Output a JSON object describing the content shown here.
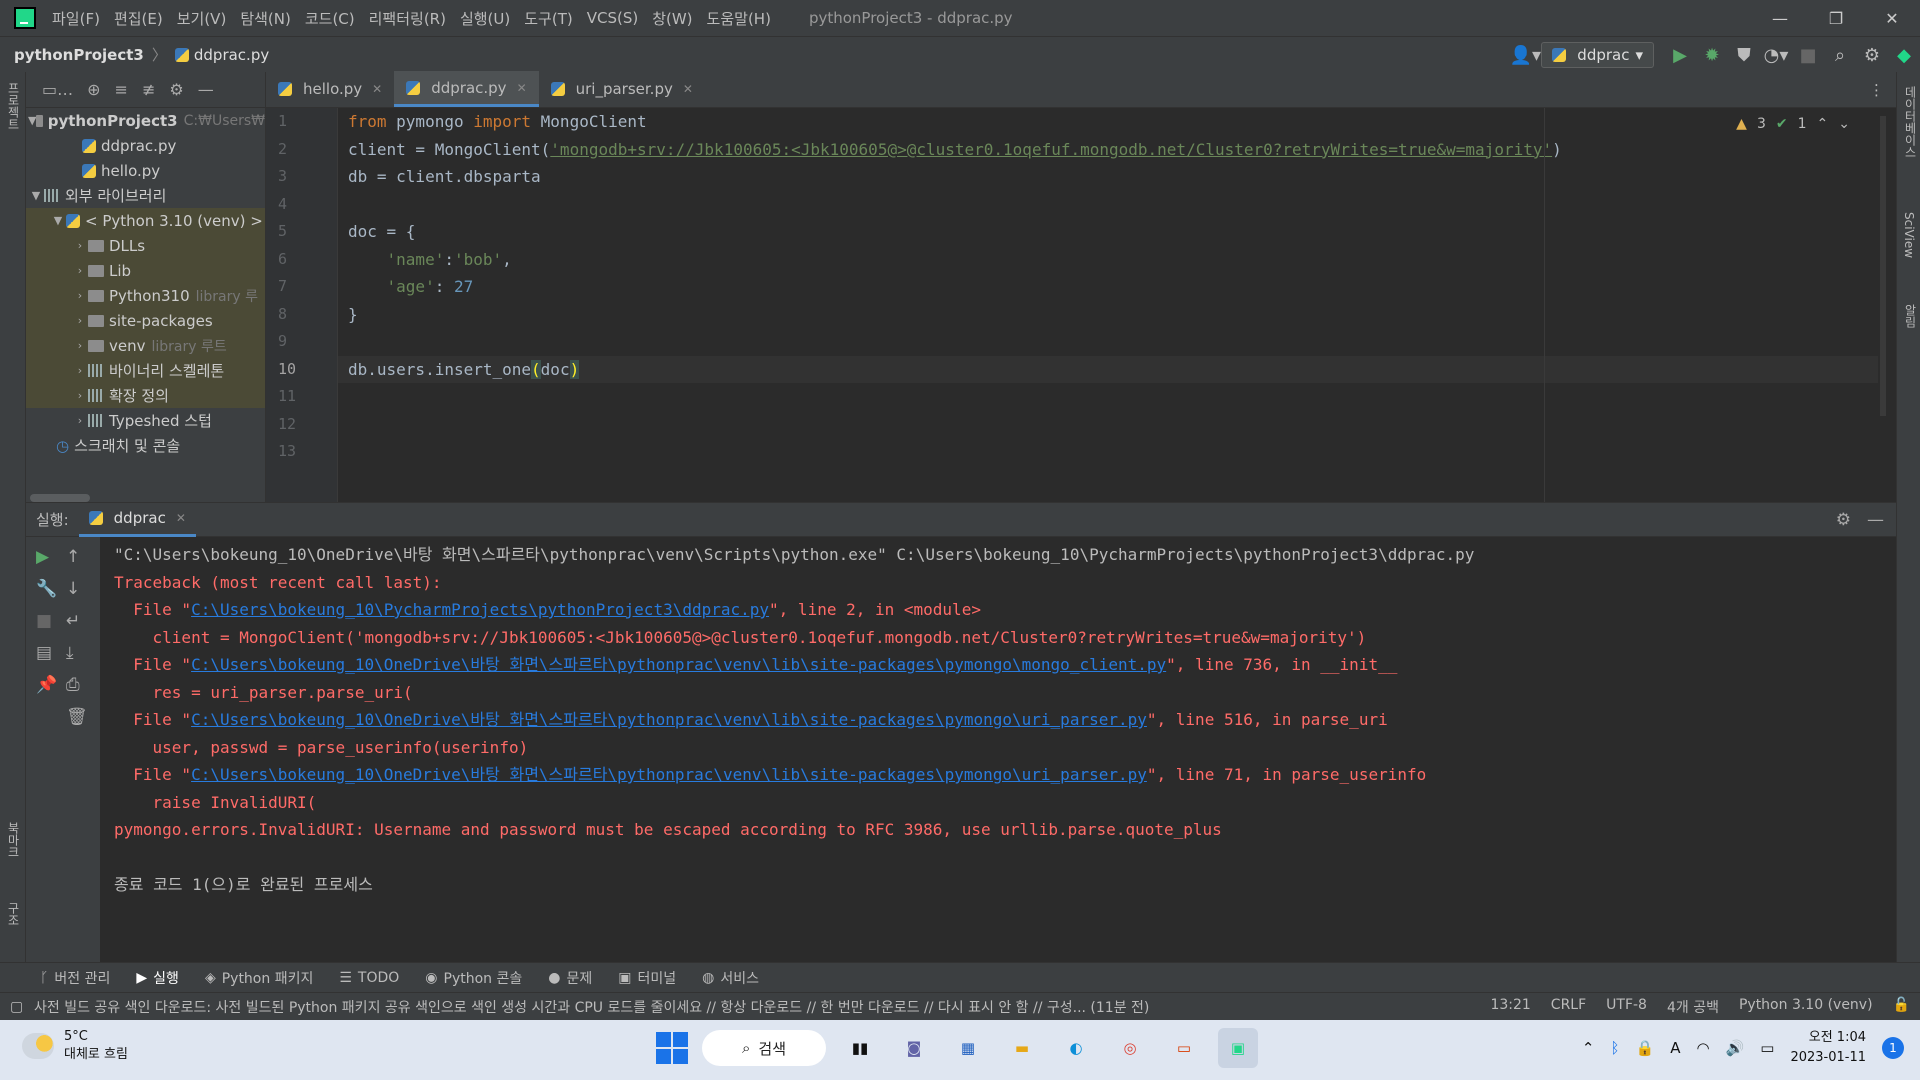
{
  "menubar": {
    "items": [
      "파일(F)",
      "편집(E)",
      "보기(V)",
      "탐색(N)",
      "코드(C)",
      "리팩터링(R)",
      "실행(U)",
      "도구(T)",
      "VCS(S)",
      "창(W)",
      "도움말(H)"
    ],
    "window_title": "pythonProject3 - ddprac.py",
    "minimize": "—",
    "restore": "❐",
    "close": "✕"
  },
  "navbar": {
    "project": "pythonProject3",
    "file": "ddprac.py",
    "run_config": "ddprac"
  },
  "left_strip": {
    "project_label": "프로젝트",
    "bookmarks_label": "북마크",
    "structure_label": "구조"
  },
  "right_strip": {
    "database_label": "데이터베이스",
    "sciview_label": "SciView",
    "notifications_label": "알림"
  },
  "project_tree": {
    "root": "pythonProject3",
    "root_hint": "C:₩Users₩",
    "files": [
      "ddprac.py",
      "hello.py"
    ],
    "external_libs": "외부 라이브러리",
    "python_env": "< Python 3.10 (venv) >",
    "children": [
      {
        "label": "DLLs",
        "hint": ""
      },
      {
        "label": "Lib",
        "hint": ""
      },
      {
        "label": "Python310",
        "hint": "library 루"
      },
      {
        "label": "site-packages",
        "hint": ""
      },
      {
        "label": "venv",
        "hint": "library 루트"
      },
      {
        "label": "바이너리 스켈레톤",
        "hint": ""
      },
      {
        "label": "확장 정의",
        "hint": ""
      },
      {
        "label": "Typeshed 스텁",
        "hint": ""
      }
    ],
    "scratches": "스크래치 및 콘솔"
  },
  "editor": {
    "tabs": [
      "hello.py",
      "ddprac.py",
      "uri_parser.py"
    ],
    "active_tab": "ddprac.py",
    "warnings": "3",
    "ok_count": "1",
    "line_numbers": [
      "1",
      "2",
      "3",
      "4",
      "5",
      "6",
      "7",
      "8",
      "9",
      "10",
      "11",
      "12",
      "13"
    ],
    "code": {
      "l1_from": "from",
      "l1_mod": " pymongo ",
      "l1_import": "import",
      "l1_rest": " MongoClient",
      "l2_pre": "client = MongoClient(",
      "l2_str": "'mongodb+srv://Jbk100605:<Jbk100605@>@cluster0.1oqefuf.mongodb.net/Cluster0?retryWrites=true&w=majority'",
      "l2_post": ")",
      "l3": "db = client.dbsparta",
      "l5": "doc = {",
      "l6_key": "    'name'",
      "l6_colon": ":",
      "l6_val": "'bob'",
      "l6_comma": ",",
      "l7_key": "    'age'",
      "l7_colon": ": ",
      "l7_val": "27",
      "l8": "}",
      "l10_pre": "db.users.insert_one",
      "l10_open": "(",
      "l10_arg": "doc",
      "l10_close": ")"
    }
  },
  "run": {
    "label": "실행:",
    "tab": "ddprac",
    "console": {
      "cmd": "\"C:\\Users\\bokeung_10\\OneDrive\\바탕 화면\\스파르타\\pythonprac\\venv\\Scripts\\python.exe\" C:\\Users\\bokeung_10\\PycharmProjects\\pythonProject3\\ddprac.py",
      "traceback": "Traceback (most recent call last):",
      "f1_pre": "  File \"",
      "f1_link": "C:\\Users\\bokeung_10\\PycharmProjects\\pythonProject3\\ddprac.py",
      "f1_post": "\", line 2, in <module>",
      "f1_code": "    client = MongoClient('mongodb+srv://Jbk100605:<Jbk100605@>@cluster0.1oqefuf.mongodb.net/Cluster0?retryWrites=true&w=majority')",
      "f2_pre": "  File \"",
      "f2_link": "C:\\Users\\bokeung_10\\OneDrive\\바탕 화면\\스파르타\\pythonprac\\venv\\lib\\site-packages\\pymongo\\mongo_client.py",
      "f2_post": "\", line 736, in __init__",
      "f2_code": "    res = uri_parser.parse_uri(",
      "f3_pre": "  File \"",
      "f3_link": "C:\\Users\\bokeung_10\\OneDrive\\바탕 화면\\스파르타\\pythonprac\\venv\\lib\\site-packages\\pymongo\\uri_parser.py",
      "f3_post": "\", line 516, in parse_uri",
      "f3_code": "    user, passwd = parse_userinfo(userinfo)",
      "f4_pre": "  File \"",
      "f4_link": "C:\\Users\\bokeung_10\\OneDrive\\바탕 화면\\스파르타\\pythonprac\\venv\\lib\\site-packages\\pymongo\\uri_parser.py",
      "f4_post": "\", line 71, in parse_userinfo",
      "f4_code": "    raise InvalidURI(",
      "error": "pymongo.errors.InvalidURI: Username and password must be escaped according to RFC 3986, use urllib.parse.quote_plus",
      "exit": "종료 코드 1(으)로 완료된 프로세스"
    }
  },
  "tool_tabs": [
    "버전 관리",
    "실행",
    "Python 패키지",
    "TODO",
    "Python 콘솔",
    "문제",
    "터미널",
    "서비스"
  ],
  "statusbar": {
    "message": "사전 빌드 공유 색인 다운로드: 사전 빌드된 Python 패키지 공유 색인으로 색인 생성 시간과 CPU 로드를 줄이세요 // 항상 다운로드 // 한 번만 다운로드 // 다시 표시 안 함 // 구성... (11분 전)",
    "position": "13:21",
    "line_sep": "CRLF",
    "encoding": "UTF-8",
    "indent": "4개 공백",
    "interpreter": "Python 3.10 (venv)"
  },
  "taskbar": {
    "temp": "5°C",
    "weather": "대체로 흐림",
    "search": "검색",
    "time": "오전 1:04",
    "date": "2023-01-11",
    "notifications": "1",
    "ime": "A"
  }
}
